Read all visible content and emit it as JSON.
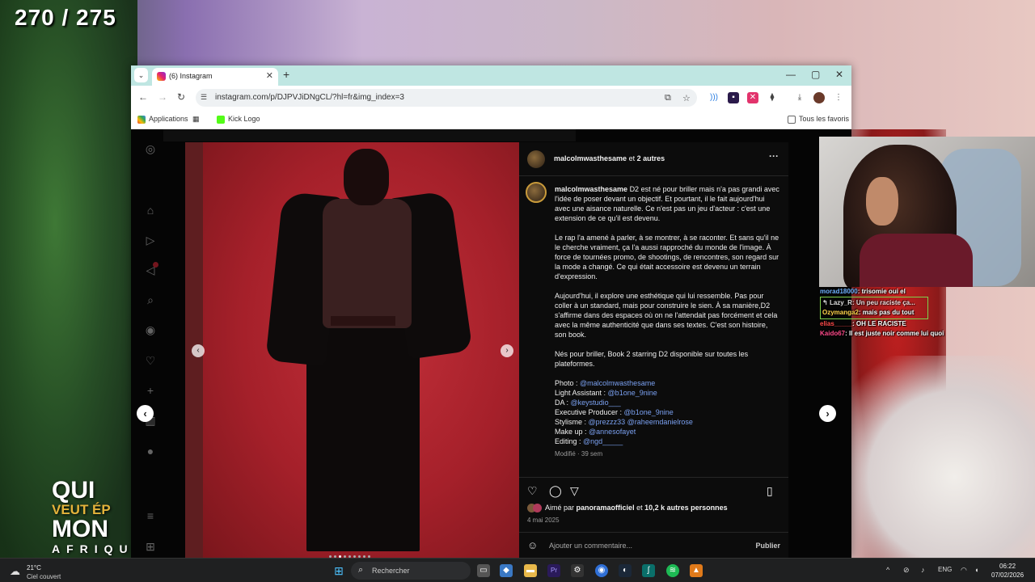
{
  "overlay": {
    "counter": "270 / 275",
    "show_logo": [
      "QUI",
      "VEUT ÉP",
      "MON",
      "AFRIQU"
    ]
  },
  "browser": {
    "tab_title": "(6) Instagram",
    "url": "instagram.com/p/DJPVJiDNgCL/?hl=fr&img_index=3",
    "bookmarks": {
      "apps": "Applications",
      "kick": "Kick Logo",
      "favorites": "Tous les favoris"
    }
  },
  "post": {
    "header_user": "malcolmwasthesame",
    "header_others": "2 autres",
    "header_connector": "et",
    "caption_user": "malcolmwasthesame",
    "paragraphs": [
      "D2 est né pour briller mais n'a pas grandi avec l'idée de poser devant un objectif. Et pourtant, il le fait aujourd'hui avec une aisance naturelle. Ce n'est pas un jeu d'acteur : c'est une extension de ce qu'il est devenu.",
      "Le rap l'a amené à parler, à se montrer, à se raconter. Et sans qu'il ne le cherche vraiment, ça l'a aussi rapproché du monde de l'image. À force de tournées promo, de shootings, de rencontres, son regard sur la mode a changé. Ce qui était accessoire est devenu un terrain d'expression.",
      "Aujourd'hui, il explore une esthétique qui lui ressemble. Pas pour coller à un standard, mais pour construire le sien. À sa manière,D2 s'affirme dans des espaces où on ne l'attendait pas forcément et cela avec la même authenticité que dans ses textes. C'est son histoire, son book.",
      "Nés pour briller, Book 2 starring D2 disponible sur toutes les plateformes."
    ],
    "credits": [
      {
        "label": "Photo : ",
        "value": "@malcolmwasthesame"
      },
      {
        "label": "Light Assistant : ",
        "value": "@b1one_9nine"
      },
      {
        "label": "DA : ",
        "value": "@keystudio___"
      },
      {
        "label": "Executive Producer : ",
        "value": "@b1one_9nine"
      },
      {
        "label": "Stylisme : ",
        "value": "@prezzz33 @raheemdanielrose"
      },
      {
        "label": "Make up : ",
        "value": "@annesofayet"
      },
      {
        "label": "Editing : ",
        "value": "@ngd_____"
      }
    ],
    "modified": "Modifié · 39 sem",
    "liked_prefix": "Aimé par",
    "liked_user": "panoramaofficiel",
    "liked_connector": "et",
    "liked_others": "10,2 k autres personnes",
    "date": "4 mai 2025",
    "comment_placeholder": "Ajouter un commentaire...",
    "publish": "Publier",
    "carousel_total": 9,
    "carousel_current": 3
  },
  "chat": [
    {
      "user": "morad18000",
      "text": ": trisomie oui el",
      "color": "#6fb3ff"
    },
    {
      "user": "Lazy_R",
      "text": ": Un peu raciste ça...",
      "color": "#ffffff",
      "reply": true
    },
    {
      "user": "Ozymanga2",
      "text": ": mais pas du tout",
      "color": "#ffd44a"
    },
    {
      "user": "elias_____",
      "text": ": OH LE RACISTE",
      "color": "#ff4a4a"
    },
    {
      "user": "Kaido67",
      "text": ": Il est juste noir comme lui quoi",
      "color": "#ff4a8a"
    }
  ],
  "taskbar": {
    "temp": "21°C",
    "condition": "Ciel couvert",
    "search": "Rechercher",
    "lang": "ENG",
    "time": "06:22",
    "date": "07/02/2026"
  },
  "colors": {
    "accent_link": "#7aa0f0",
    "tab_bar": "#bfe6e2",
    "photo_red": "#b0242c"
  }
}
